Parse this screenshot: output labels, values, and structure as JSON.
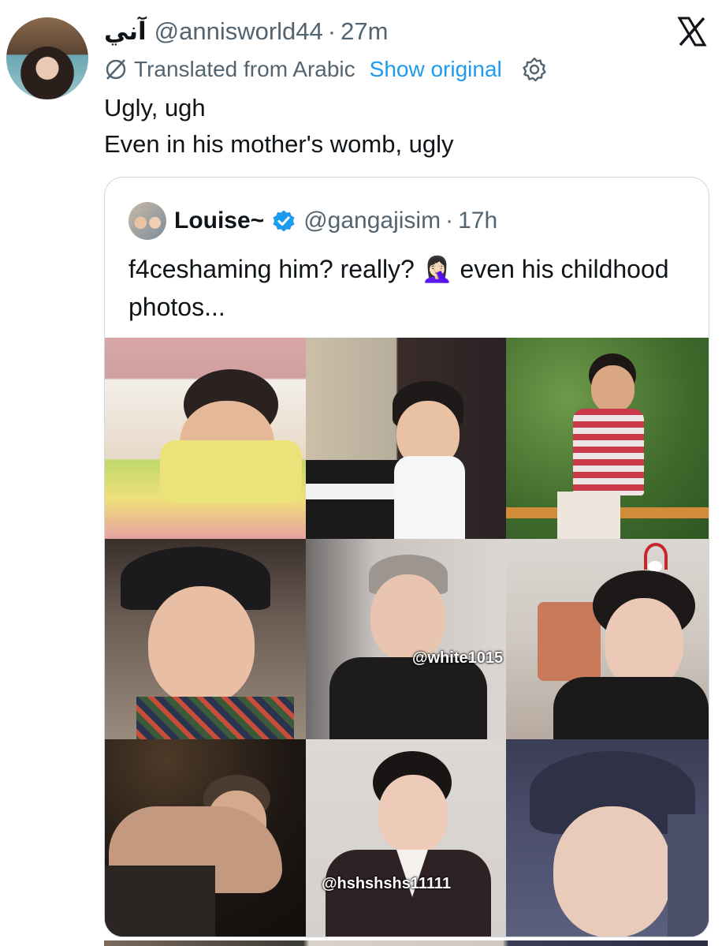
{
  "tweet": {
    "display_name": "آني",
    "handle": "@annisworld44",
    "separator": "·",
    "time": "27m",
    "translated_label": "Translated from Arabic",
    "show_original": "Show original",
    "text": "Ugly, ugh\nEven in his mother's womb, ugly"
  },
  "quote": {
    "display_name": "Louise~",
    "handle": "@gangajisim",
    "separator": "·",
    "time": "17h",
    "text": "f4ceshaming him? really?",
    "emoji": "🤦🏻‍♀️",
    "text_after": "even his childhood photos...",
    "photos": [
      {
        "alt": "toddler sleeping on pillow"
      },
      {
        "alt": "toddler with headphones at piano"
      },
      {
        "alt": "boy in striped shirt making peace sign"
      },
      {
        "alt": "young man in black cap"
      },
      {
        "alt": "young man in grey cap making peace sign",
        "watermark": "@white1015"
      },
      {
        "alt": "young man with antler headband"
      },
      {
        "alt": "young man in tank top at night"
      },
      {
        "alt": "young man in school uniform",
        "watermark": "@hshshshs11111"
      },
      {
        "alt": "young man in denim cap"
      }
    ]
  },
  "icons": {
    "x_logo": "x-logo-icon",
    "translate": "slash-circle-icon",
    "settings": "gear-icon",
    "verified": "verified-badge-icon"
  },
  "colors": {
    "link": "#1d9bf0",
    "secondary_text": "#536471",
    "primary_text": "#0f1419",
    "border": "#cfd9de"
  }
}
